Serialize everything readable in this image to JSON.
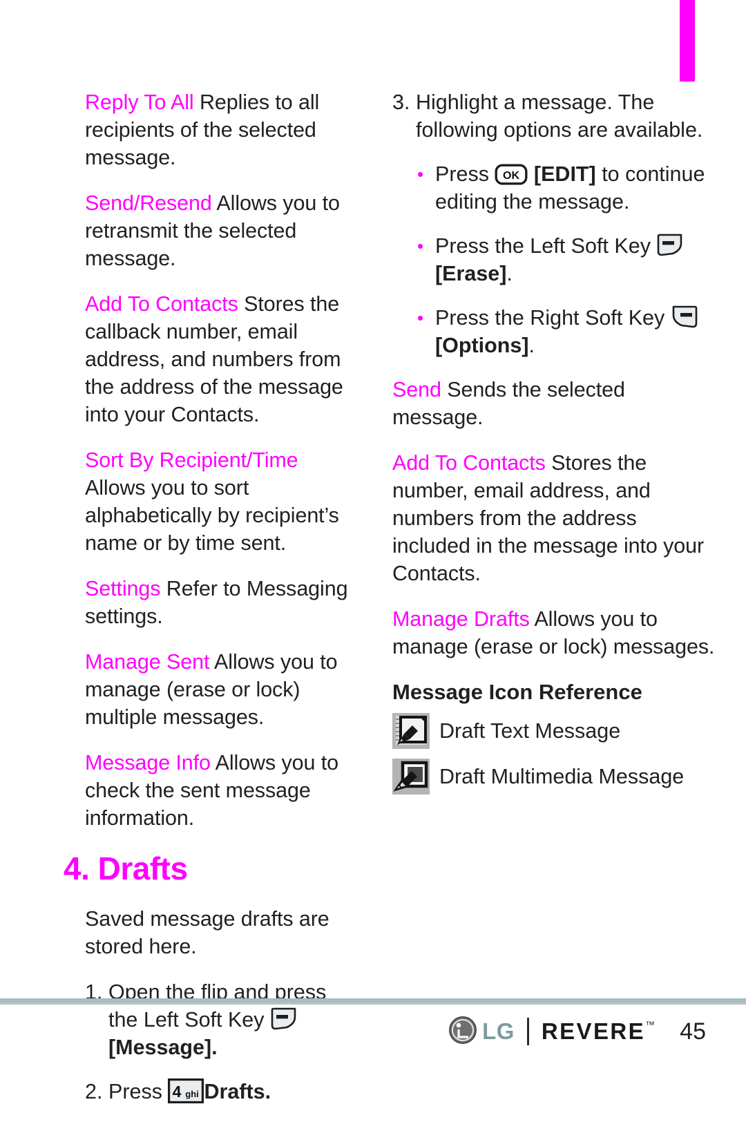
{
  "page": {
    "number": "45",
    "accent_color": "#ff00ff",
    "text_color": "#231f20",
    "rule_color": "#a6bdc2"
  },
  "section_tab": {
    "name": "messaging-section-tab",
    "color": "#ff00ff"
  },
  "left_column": {
    "entries": [
      {
        "term": "Reply To All",
        "desc": " Replies to all recipients of the selected message."
      },
      {
        "term": "Send/Resend",
        "desc": " Allows you to retransmit the selected message."
      },
      {
        "term": "Add To Contacts",
        "desc": " Stores the callback number, email address, and numbers from the address of the message into your Contacts."
      },
      {
        "term": "Sort By Recipient/Time",
        "desc": " Allows you to sort alphabetically by recipient’s name or by time sent."
      },
      {
        "term": "Settings",
        "desc": " Refer to Messaging settings."
      },
      {
        "term": "Manage Sent",
        "desc": " Allows you to manage (erase or lock) multiple messages."
      },
      {
        "term": "Message Info",
        "desc": " Allows you to check the sent message information."
      }
    ],
    "section_heading": "4. Drafts",
    "intro": "Saved message drafts are stored here.",
    "steps": [
      {
        "number": "1.",
        "text_before": "Open the flip and press the Left Soft Key ",
        "icon": "left-soft-key-icon",
        "text_after": "[Message].",
        "after_bold": true
      },
      {
        "number": "2.",
        "text_before": "Press ",
        "icon": "key-4-ghi-icon",
        "text_after": "Drafts.",
        "after_bold": true
      }
    ],
    "key_4_label": {
      "digit": "4",
      "letters": "ghi"
    }
  },
  "right_column": {
    "step": {
      "number": "3.",
      "text": "Highlight a message. The following options are available."
    },
    "bullets": [
      {
        "text_before": "Press ",
        "icon": "ok-key-icon",
        "icon_label": "OK",
        "text_bold": "[EDIT]",
        "text_after": " to continue editing the message."
      },
      {
        "text_before": "Press the Left Soft Key ",
        "icon": "left-soft-key-icon",
        "icon_label": "",
        "text_bold": "[Erase]",
        "text_after": "."
      },
      {
        "text_before": "Press the Right Soft Key ",
        "icon": "right-soft-key-icon",
        "icon_label": "",
        "text_bold": "[Options]",
        "text_after": "."
      }
    ],
    "entries": [
      {
        "term": "Send",
        "desc": "  Sends the selected message."
      },
      {
        "term": "Add To Contacts",
        "desc": "  Stores the number, email address, and numbers from the address included in the message into your Contacts."
      },
      {
        "term": "Manage Drafts",
        "desc": "  Allows you to manage (erase or lock) messages."
      }
    ],
    "icon_reference": {
      "heading": "Message Icon Reference",
      "rows": [
        {
          "icon": "draft-text-message-icon",
          "label": "Draft Text Message"
        },
        {
          "icon": "draft-multimedia-message-icon",
          "label": "Draft Multimedia Message"
        }
      ]
    }
  },
  "footer": {
    "brand": "LG",
    "product": "REVERE",
    "trademark": "™",
    "page_number": "45"
  }
}
